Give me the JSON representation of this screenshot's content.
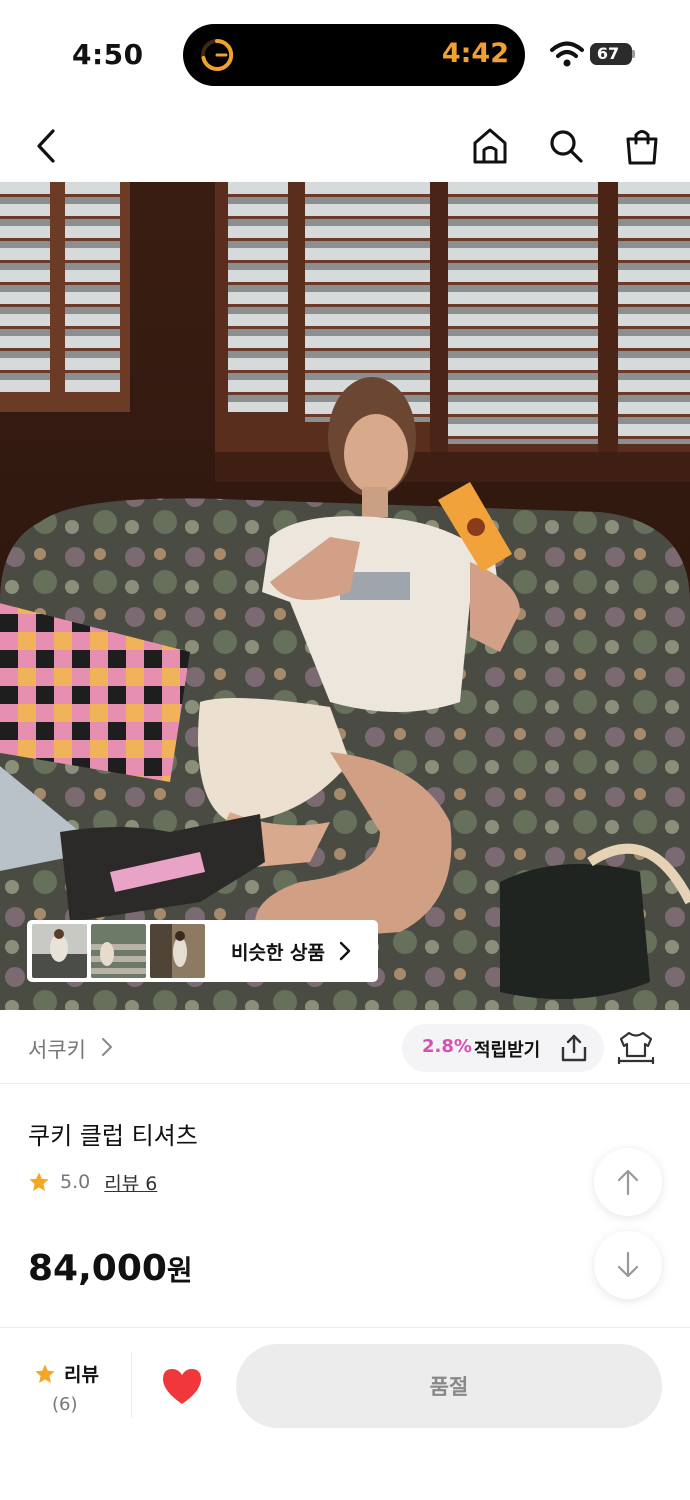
{
  "status_bar": {
    "time": "4:50",
    "activity_timer": "4:42",
    "battery": "67",
    "battery_level_percent": 67
  },
  "nav": {
    "icons": [
      "back-arrow-icon",
      "home-icon",
      "search-icon",
      "shopping-bag-icon"
    ]
  },
  "similar_products": {
    "label": "비슷한 상품"
  },
  "brand": {
    "name": "서쿠키",
    "points_rate": "2.8%",
    "points_label": "적립받기"
  },
  "product": {
    "title": "쿠키 클럽 티셔츠",
    "rating": "5.0",
    "review_link": "리뷰 6",
    "price": "84,000",
    "price_unit": "원"
  },
  "bottom_bar": {
    "review_label": "리뷰",
    "review_count": "(6)",
    "buy_label": "품절"
  },
  "colors": {
    "accent_pink": "#d94fb5",
    "star": "#f5a623",
    "heart": "#f0373c",
    "timer": "#f0a12e"
  }
}
